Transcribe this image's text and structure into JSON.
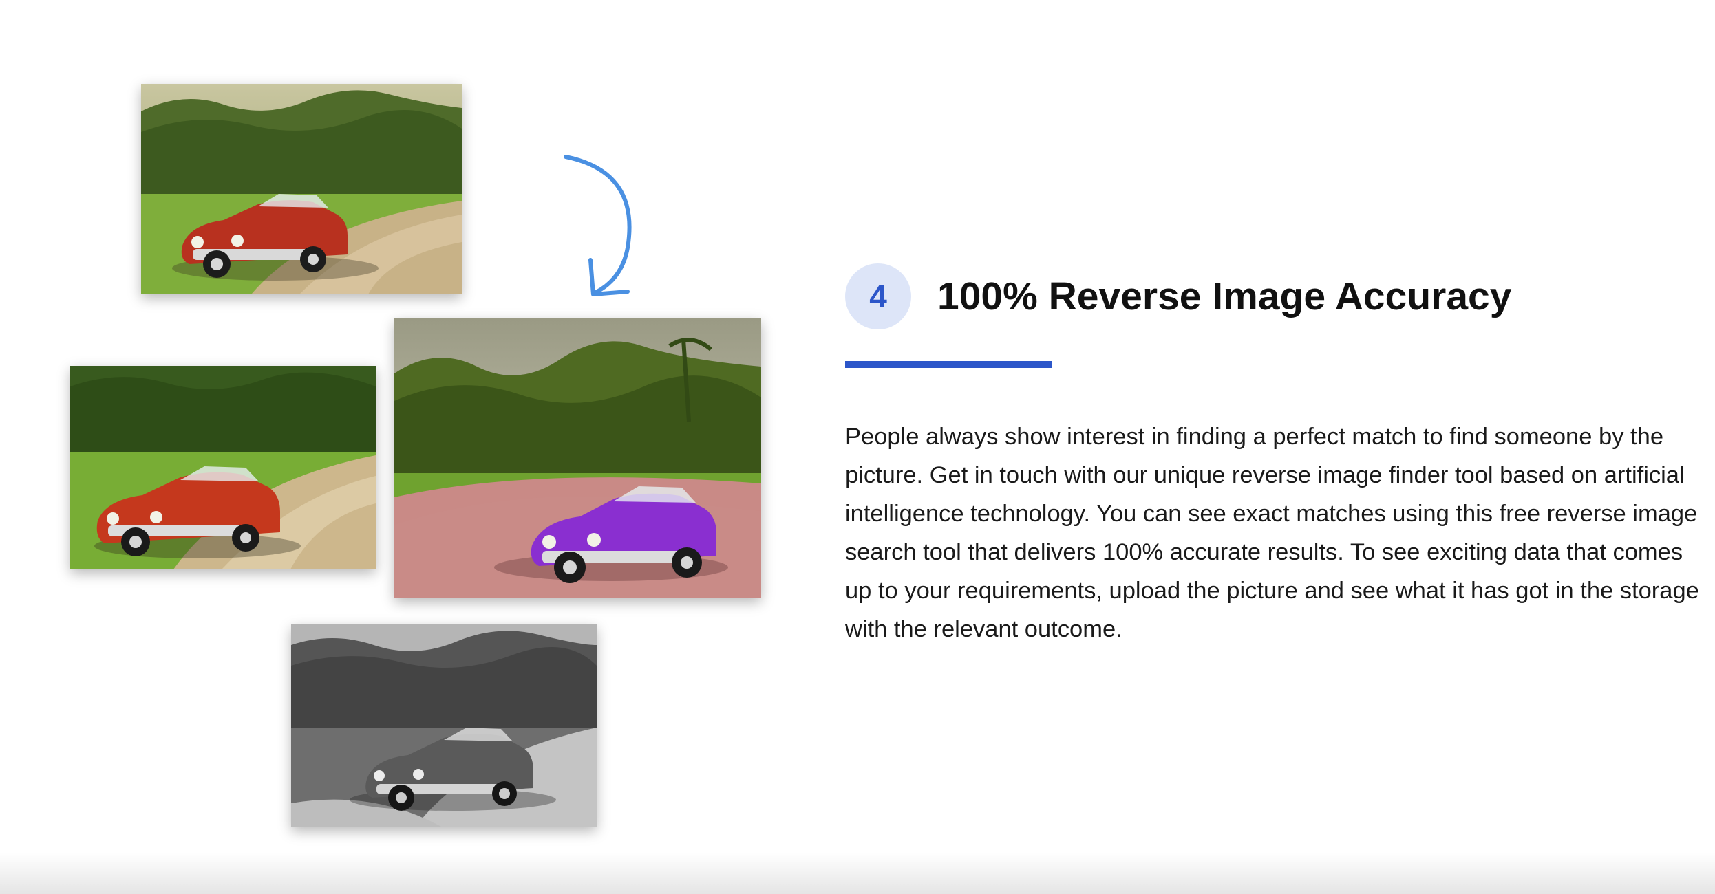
{
  "feature": {
    "step_number": "4",
    "title": "100% Reverse Image Accuracy",
    "description": "People always show interest in finding a perfect match to find someone by the picture. Get in touch with our unique reverse image finder tool based on artificial intelligence technology. You can see exact matches using this free reverse image search tool that delivers 100% accurate results. To see exciting data that comes up to your requirements, upload the picture and see what it has got in the storage with the relevant outcome."
  },
  "colors": {
    "accent": "#2c56c9",
    "badge_background": "#dde5f8",
    "arrow": "#4a90e2"
  },
  "images": [
    {
      "name": "car-photo-original",
      "variant": "red car, warm tone"
    },
    {
      "name": "car-photo-red",
      "variant": "red car, saturated"
    },
    {
      "name": "car-photo-purple",
      "variant": "purple car, pink road"
    },
    {
      "name": "car-photo-grayscale",
      "variant": "grayscale"
    }
  ],
  "icons": {
    "arrow": "curved-arrow-icon"
  }
}
